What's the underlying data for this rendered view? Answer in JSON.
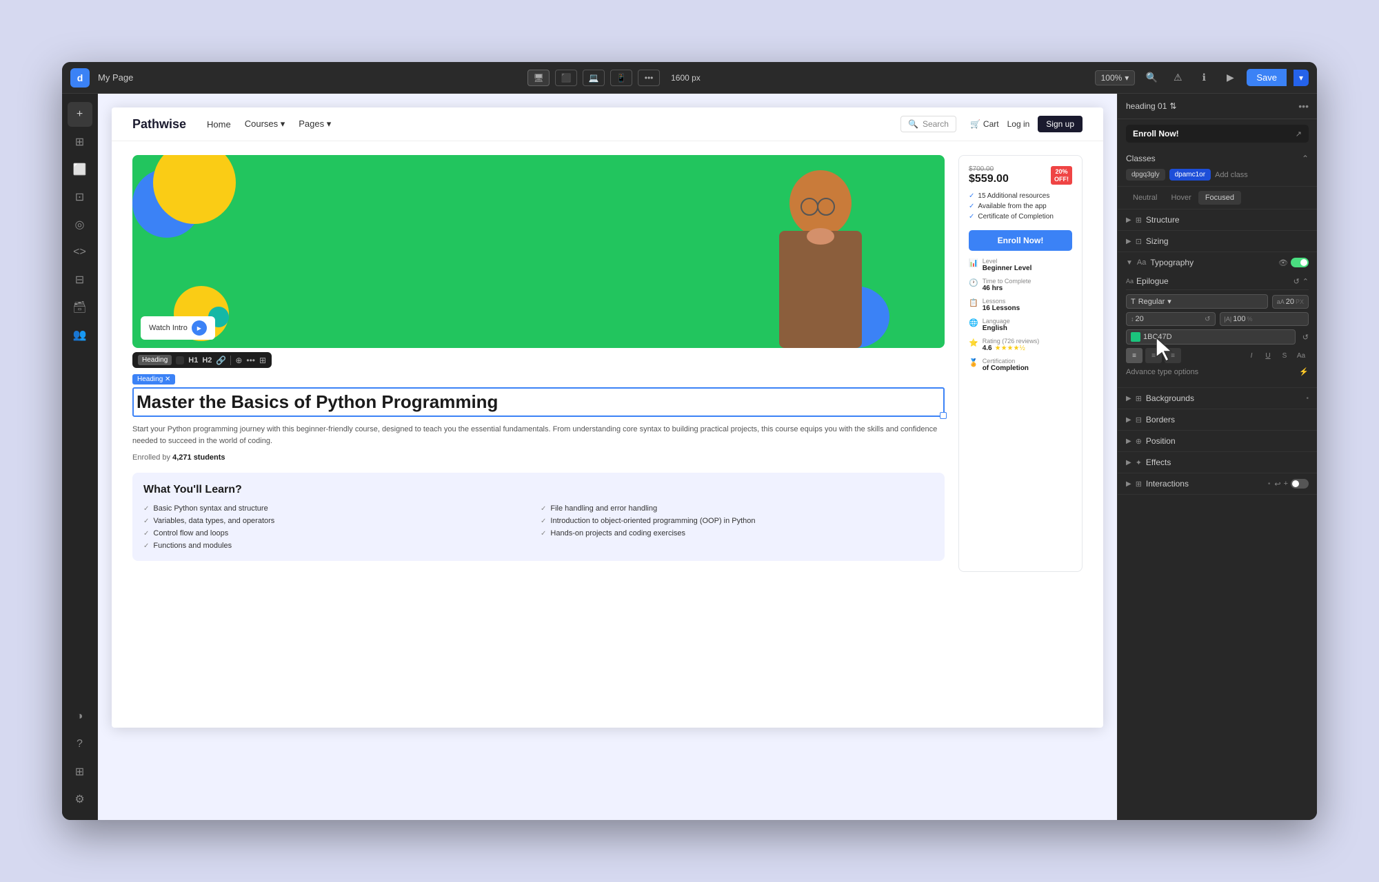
{
  "app": {
    "logo": "d",
    "page_title": "My Page"
  },
  "topbar": {
    "zoom": "100%",
    "viewport": "1600 px",
    "save_label": "Save"
  },
  "devices": [
    {
      "id": "desktop",
      "icon": "▬",
      "active": true
    },
    {
      "id": "tablet-landscape",
      "icon": "▭",
      "active": false
    },
    {
      "id": "laptop",
      "icon": "⬛",
      "active": false
    },
    {
      "id": "mobile",
      "icon": "▮",
      "active": false
    }
  ],
  "sidebar": {
    "items": [
      {
        "id": "add",
        "icon": "+"
      },
      {
        "id": "layers",
        "icon": "⊞"
      },
      {
        "id": "pages",
        "icon": "⬜"
      },
      {
        "id": "media",
        "icon": "🖼"
      },
      {
        "id": "components",
        "icon": "◎"
      },
      {
        "id": "code",
        "icon": "<>"
      },
      {
        "id": "grid",
        "icon": "⊟"
      },
      {
        "id": "database",
        "icon": "🗃"
      },
      {
        "id": "team",
        "icon": "👥"
      },
      {
        "id": "contrast",
        "icon": "◑"
      },
      {
        "id": "help",
        "icon": "?"
      },
      {
        "id": "library",
        "icon": "⊞"
      },
      {
        "id": "settings",
        "icon": "⚙"
      }
    ]
  },
  "site": {
    "nav": {
      "logo": "Pathwise",
      "links": [
        "Home",
        "Courses",
        "Pages"
      ],
      "search_placeholder": "Search",
      "cart_label": "Cart",
      "login_label": "Log in",
      "signup_label": "Sign up"
    },
    "hero": {
      "watch_intro": "Watch Intro",
      "heading_label": "Heading",
      "heading": "Master the Basics of Python Programming",
      "description": "Start your Python programming journey with this beginner-friendly course, designed to teach you the essential fundamentals. From understanding core syntax to building practical projects, this course equips you with the skills and confidence needed to succeed in the world of coding.",
      "enrolled_prefix": "Enrolled by",
      "enrolled_count": "4,271 students"
    },
    "course_card": {
      "original_price": "$700.00",
      "current_price": "$559.00",
      "discount": "20%\nOFF!",
      "features": [
        "15 Additional resources",
        "Available from the app",
        "Certificate of Completion"
      ],
      "enroll_btn": "Enroll Now!",
      "level_label": "Level",
      "level_value": "Beginner Level",
      "time_label": "Time to Complete",
      "time_value": "46 hrs",
      "lessons_label": "Lessons",
      "lessons_value": "16 Lessons",
      "language_label": "Language",
      "language_value": "English",
      "rating_label": "Rating",
      "rating_value": "4.6",
      "rating_count": "(726 reviews)",
      "certification_label": "Certification",
      "certification_value": "of Completion"
    },
    "learn_section": {
      "title": "What You'll Learn?",
      "items": [
        "Basic Python syntax and structure",
        "Variables, data types, and operators",
        "Control flow and loops",
        "Functions and modules",
        "File handling and error handling",
        "Introduction to object-oriented programming (OOP) in Python",
        "Hands-on projects and coding exercises"
      ]
    }
  },
  "right_panel": {
    "element_tag": "heading 01",
    "enroll_preview": "Enroll Now!",
    "classes": {
      "title": "Classes",
      "tags": [
        "dpgq3gly",
        "dpamc1or"
      ],
      "add_label": "Add class"
    },
    "states": [
      "Neutral",
      "Hover",
      "Focused"
    ],
    "active_state": "Focused",
    "sections": [
      {
        "id": "structure",
        "title": "Structure",
        "icon": "⊞",
        "expanded": false
      },
      {
        "id": "sizing",
        "title": "Sizing",
        "icon": "⊡",
        "expanded": false
      },
      {
        "id": "typography",
        "title": "Typography",
        "icon": "Aa",
        "expanded": true
      },
      {
        "id": "backgrounds",
        "title": "Backgrounds",
        "icon": "⊞",
        "expanded": false,
        "has_dot": true
      },
      {
        "id": "borders",
        "title": "Borders",
        "icon": "⊞",
        "expanded": false
      },
      {
        "id": "position",
        "title": "Position",
        "icon": "⊞",
        "expanded": false
      },
      {
        "id": "effects",
        "title": "Effects",
        "icon": "✦",
        "expanded": false
      },
      {
        "id": "interactions",
        "title": "Interactions",
        "icon": "⊞",
        "expanded": false,
        "has_dot": true
      }
    ],
    "typography": {
      "font_name": "Epilogue",
      "weight": "Regular",
      "size": "20",
      "size_unit": "PX",
      "line_height": "20",
      "letter_spacing": "100",
      "letter_unit": "%",
      "color": "1BC47D",
      "advance_type_label": "Advance type options"
    }
  }
}
